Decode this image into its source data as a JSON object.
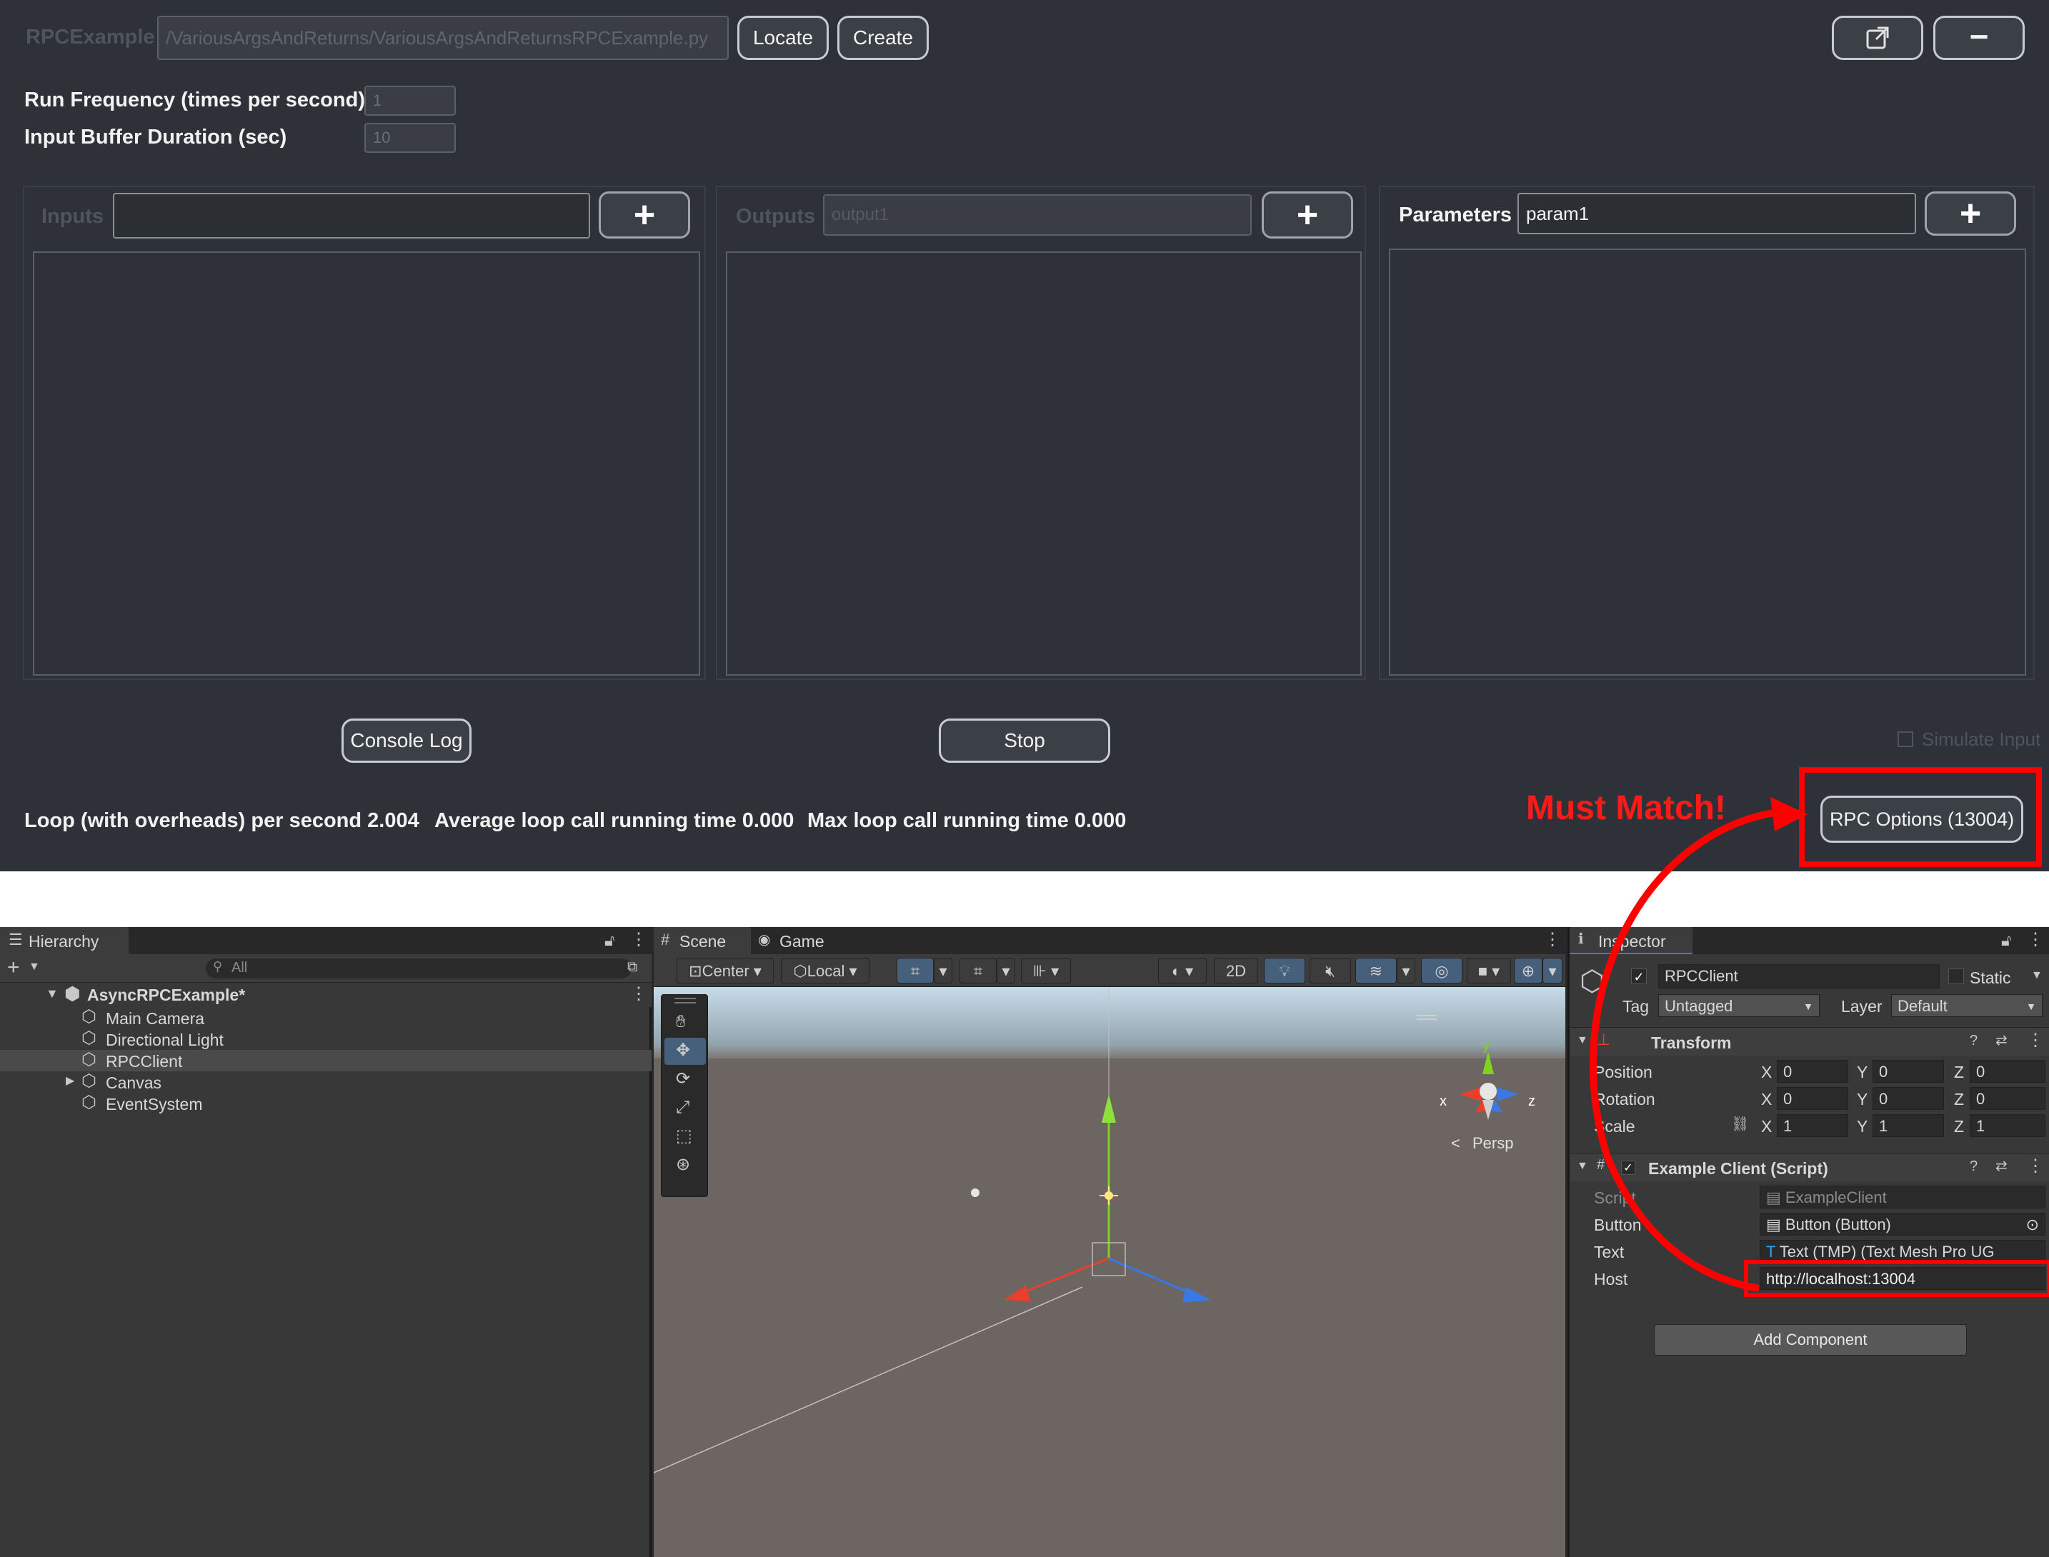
{
  "rpc_window": {
    "title": "RPCExample",
    "script_path": "/VariousArgsAndReturns/VariousArgsAndReturnsRPCExample.py",
    "locate_label": "Locate",
    "create_label": "Create",
    "run_frequency_label": "Run Frequency (times per second)",
    "run_frequency_value": "1",
    "input_buffer_label": "Input Buffer Duration (sec)",
    "input_buffer_value": "10",
    "inputs_label": "Inputs",
    "inputs_value": "",
    "outputs_label": "Outputs",
    "outputs_placeholder": "output1",
    "parameters_label": "Parameters",
    "parameters_value": "param1",
    "plus_label": "+",
    "console_log_label": "Console Log",
    "stop_label": "Stop",
    "simulate_input_label": "Simulate Input",
    "loop_stat": "Loop (with overheads) per second 2.004",
    "avg_stat": "Average loop call running time 0.000",
    "max_stat": "Max loop call running time 0.000",
    "rpc_options_label": "RPC Options (13004)",
    "minimize_label": "−",
    "annotation": "Must Match!"
  },
  "hierarchy": {
    "tab_label": "Hierarchy",
    "search_placeholder": "All",
    "scene_name": "AsyncRPCExample*",
    "items": [
      {
        "label": "Main Camera"
      },
      {
        "label": "Directional Light"
      },
      {
        "label": "RPCClient"
      },
      {
        "label": "Canvas"
      },
      {
        "label": "EventSystem"
      }
    ]
  },
  "scene_view": {
    "scene_tab": "Scene",
    "game_tab": "Game",
    "pivot_mode": "Center",
    "pivot_rotation": "Local",
    "mode_2d": "2D",
    "persp_label": "Persp",
    "gizmo_x": "x",
    "gizmo_y": "y",
    "gizmo_z": "z"
  },
  "inspector": {
    "tab_label": "Inspector",
    "object_name": "RPCClient",
    "static_label": "Static",
    "tag_label": "Tag",
    "tag_value": "Untagged",
    "layer_label": "Layer",
    "layer_value": "Default",
    "transform": {
      "title": "Transform",
      "rows": [
        {
          "label": "Position",
          "x": "0",
          "y": "0",
          "z": "0"
        },
        {
          "label": "Rotation",
          "x": "0",
          "y": "0",
          "z": "0"
        },
        {
          "label": "Scale",
          "x": "1",
          "y": "1",
          "z": "1"
        }
      ],
      "axis_x": "X",
      "axis_y": "Y",
      "axis_z": "Z"
    },
    "script_component": {
      "title": "Example Client (Script)",
      "script_label": "Script",
      "script_value": "ExampleClient",
      "button_label": "Button",
      "button_value": "Button (Button)",
      "text_label": "Text",
      "text_value": "Text (TMP) (Text Mesh Pro UG",
      "host_label": "Host",
      "host_value": "http://localhost:13004"
    },
    "add_component_label": "Add Component"
  },
  "colors": {
    "annotation_red": "#ff0000",
    "window_bg": "#2e3238",
    "unity_bg": "#282828",
    "selection_blue": "#46607c"
  }
}
